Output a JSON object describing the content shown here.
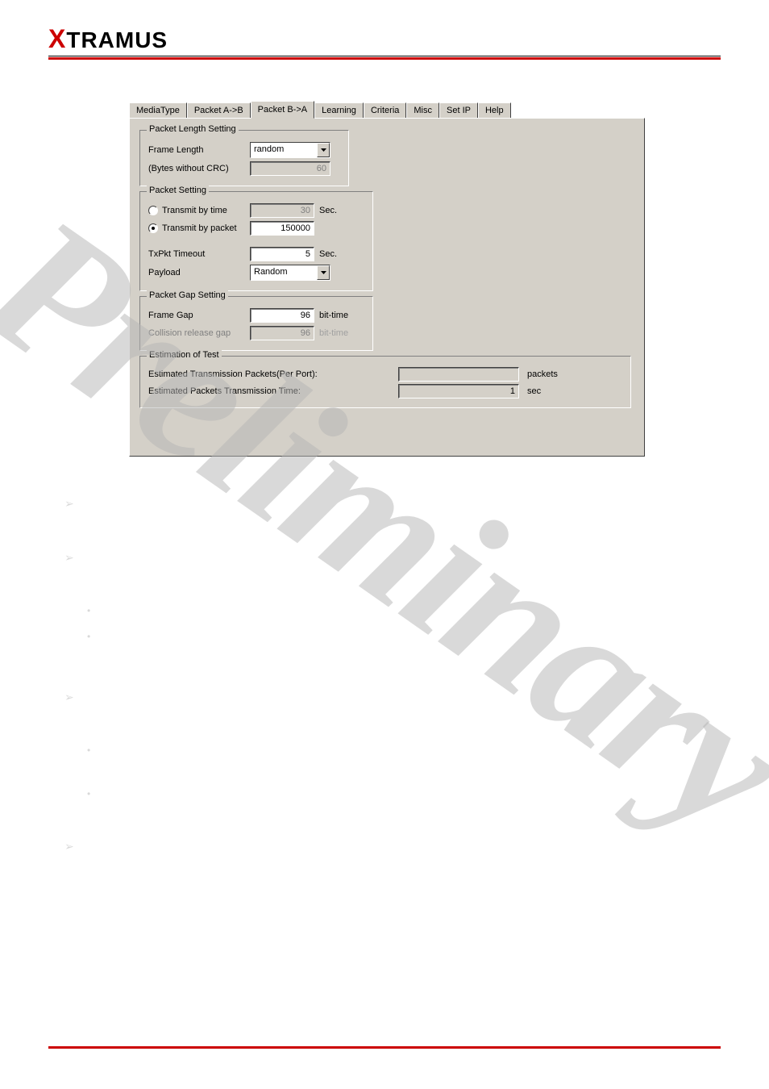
{
  "brand": {
    "x": "X",
    "rest": "TRAMUS"
  },
  "tabs": {
    "mediaType": "MediaType",
    "packetAB": "Packet A->B",
    "packetBA": "Packet B->A",
    "learning": "Learning",
    "criteria": "Criteria",
    "misc": "Misc",
    "setIP": "Set IP",
    "help": "Help"
  },
  "groups": {
    "pktLen": {
      "legend": "Packet Length Setting",
      "frameLength": "Frame Length",
      "frameLengthValue": "random",
      "bytesLabel": "(Bytes without CRC)",
      "bytesValue": "60"
    },
    "pktSet": {
      "legend": "Packet Setting",
      "txTime": "Transmit by time",
      "txTimeValue": "30",
      "txTimeUnit": "Sec.",
      "txPacket": "Transmit by packet",
      "txPacketValue": "150000",
      "txTimeout": "TxPkt Timeout",
      "txTimeoutValue": "5",
      "txTimeoutUnit": "Sec.",
      "payload": "Payload",
      "payloadValue": "Random"
    },
    "pktGap": {
      "legend": "Packet Gap Setting",
      "frameGap": "Frame Gap",
      "frameGapValue": "96",
      "frameGapUnit": "bit-time",
      "collision": "Collision release gap",
      "collisionValue": "96",
      "collisionUnit": "bit-time"
    },
    "est": {
      "legend": "Estimation of Test",
      "pktsLabel": "Estimated Transmission Packets(Per Port):",
      "pktsValue": "",
      "pktsUnit": "packets",
      "timeLabel": "Estimated Packets Transmission Time:",
      "timeValue": "1",
      "timeUnit": "sec"
    }
  },
  "watermark": "Preliminary"
}
